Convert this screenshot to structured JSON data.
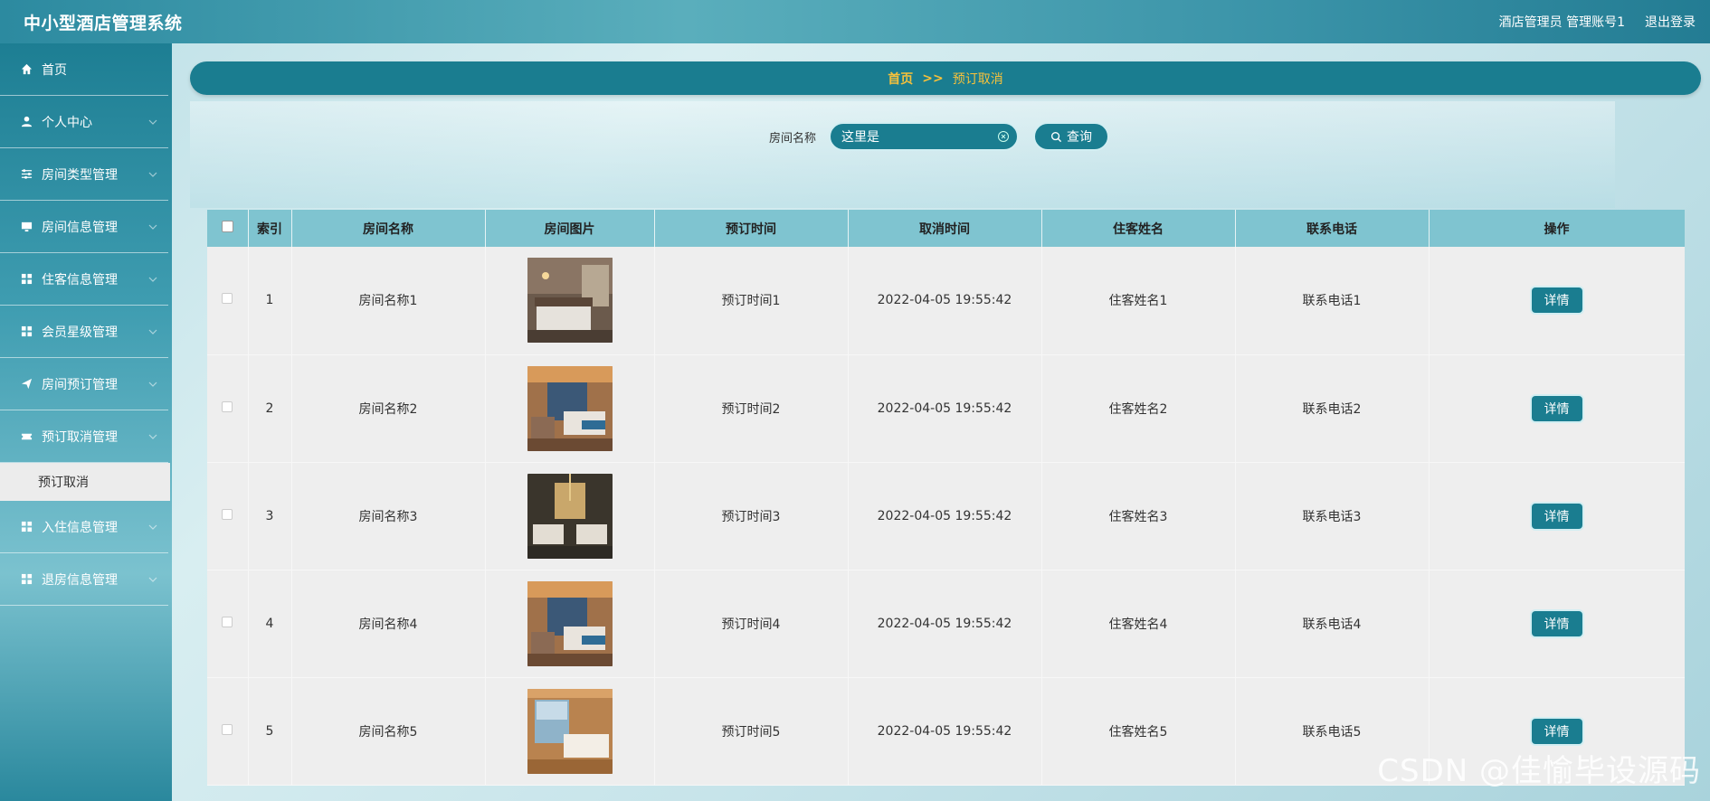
{
  "app": {
    "title": "中小型酒店管理系统"
  },
  "header": {
    "user": "酒店管理员 管理账号1",
    "logout": "退出登录"
  },
  "sidebar": {
    "items": [
      {
        "label": "首页",
        "icon": "home-icon",
        "expandable": false
      },
      {
        "label": "个人中心",
        "icon": "user-icon",
        "expandable": true
      },
      {
        "label": "房间类型管理",
        "icon": "sliders-icon",
        "expandable": true
      },
      {
        "label": "房间信息管理",
        "icon": "monitor-icon",
        "expandable": true
      },
      {
        "label": "住客信息管理",
        "icon": "grid-icon",
        "expandable": true
      },
      {
        "label": "会员星级管理",
        "icon": "grid-icon",
        "expandable": true
      },
      {
        "label": "房间预订管理",
        "icon": "send-icon",
        "expandable": true
      },
      {
        "label": "预订取消管理",
        "icon": "ticket-icon",
        "expandable": true
      },
      {
        "label": "入住信息管理",
        "icon": "grid-icon",
        "expandable": true
      },
      {
        "label": "退房信息管理",
        "icon": "grid-icon",
        "expandable": true
      }
    ],
    "active_sub": "预订取消"
  },
  "breadcrumb": {
    "home": "首页",
    "sep": ">>",
    "current": "预订取消"
  },
  "search": {
    "label": "房间名称",
    "value": "这里是",
    "button": "查询"
  },
  "table": {
    "headers": [
      "索引",
      "房间名称",
      "房间图片",
      "预订时间",
      "取消时间",
      "住客姓名",
      "联系电话",
      "操作"
    ],
    "rows": [
      {
        "index": "1",
        "name": "房间名称1",
        "booked": "预订时间1",
        "cancelled": "2022-04-05 19:55:42",
        "guest": "住客姓名1",
        "phone": "联系电话1",
        "action": "详情"
      },
      {
        "index": "2",
        "name": "房间名称2",
        "booked": "预订时间2",
        "cancelled": "2022-04-05 19:55:42",
        "guest": "住客姓名2",
        "phone": "联系电话2",
        "action": "详情"
      },
      {
        "index": "3",
        "name": "房间名称3",
        "booked": "预订时间3",
        "cancelled": "2022-04-05 19:55:42",
        "guest": "住客姓名3",
        "phone": "联系电话3",
        "action": "详情"
      },
      {
        "index": "4",
        "name": "房间名称4",
        "booked": "预订时间4",
        "cancelled": "2022-04-05 19:55:42",
        "guest": "住客姓名4",
        "phone": "联系电话4",
        "action": "详情"
      },
      {
        "index": "5",
        "name": "房间名称5",
        "booked": "预订时间5",
        "cancelled": "2022-04-05 19:55:42",
        "guest": "住客姓名5",
        "phone": "联系电话5",
        "action": "详情"
      }
    ]
  },
  "watermark": "CSDN @佳愉毕设源码",
  "colors": {
    "primary": "#1a7d90",
    "header_row": "#7fc4d0",
    "accent": "#f6c13b"
  }
}
